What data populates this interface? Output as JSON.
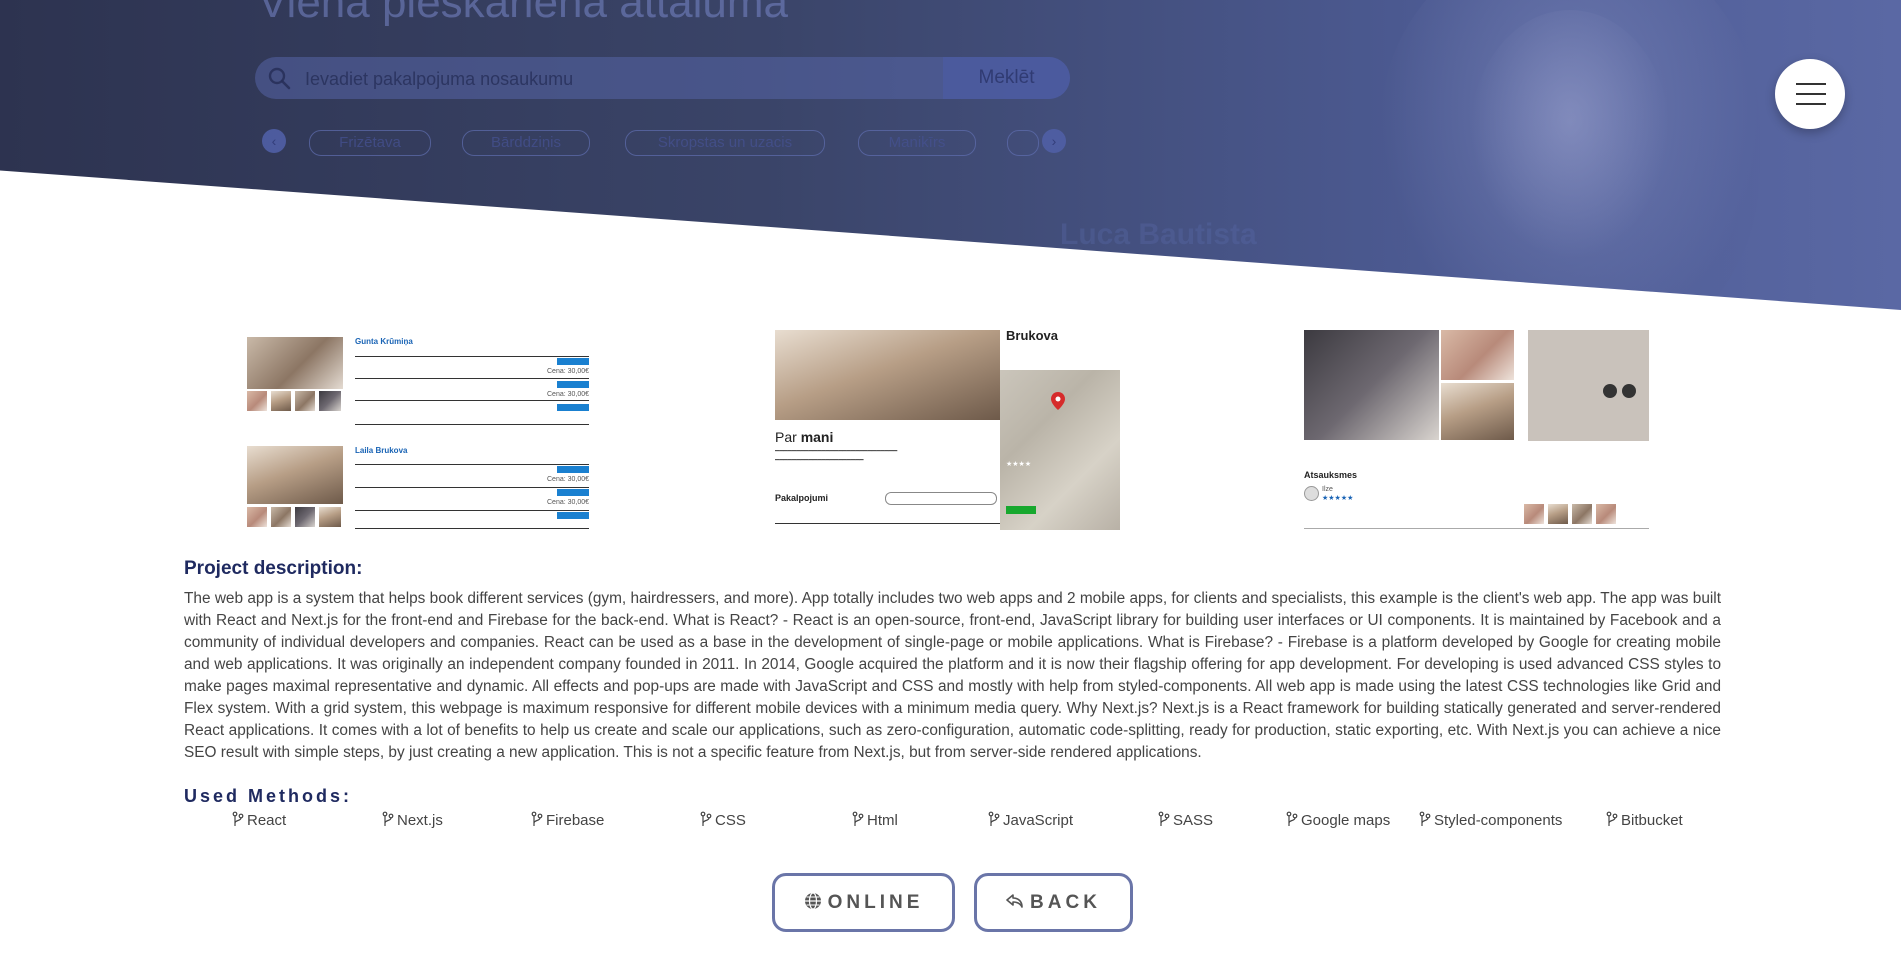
{
  "hero": {
    "title": "Vienā pieskārienā attālumā",
    "search_placeholder": "Ievadiet pakalpojuma nosaukumu",
    "search_button": "Meklēt",
    "categories": [
      "Frizētava",
      "Bārddziņis",
      "Skropstas un uzacis",
      "Manikīrs"
    ],
    "specialist_name": "Luca Bautista"
  },
  "screens": {
    "list": {
      "name1": "Gunta Krūmiņa",
      "name2": "Laila Brukova",
      "book_label": "Rezervēt",
      "price_label": "Cena: 30,00€"
    },
    "profile": {
      "name": "Brukova",
      "about_prefix": "Par",
      "about_bold": "mani",
      "services_label": "Pakalpojumi",
      "search_placeholder": "Ievadiet pakalpojuma nosaukumu"
    },
    "reviews": {
      "title": "Atsauksmes",
      "reviewer": "Ilze"
    }
  },
  "description": {
    "title": "Project description:",
    "text": "The web app is a system that helps book different services (gym, hairdressers, and more). App totally includes two web apps and 2 mobile apps, for clients and specialists, this example is the client's web app. The app was built with React and Next.js for the front-end and Firebase for the back-end. What is React? - React is an open-source, front-end, JavaScript library for building user interfaces or UI components. It is maintained by Facebook and a community of individual developers and companies. React can be used as a base in the development of single-page or mobile applications. What is Firebase? - Firebase is a platform developed by Google for creating mobile and web applications. It was originally an independent company founded in 2011. In 2014, Google acquired the platform and it is now their flagship offering for app development. For developing is used advanced CSS styles to make pages maximal representative and dynamic. All effects and pop-ups are made with JavaScript and CSS and mostly with help from styled-components. All web app is made using the latest CSS technologies like Grid and Flex system. With a grid system, this webpage is maximum responsive for different mobile devices with a minimum media query. Why Next.js? Next.js is a React framework for building statically generated and server-rendered React applications. It comes with a lot of benefits to help us create and scale our applications, such as zero-configuration, automatic code-splitting, ready for production, static exporting, etc. With Next.js you can achieve a nice SEO result with simple steps, by just creating a new application. This is not a specific feature from Next.js, but from server-side rendered applications."
  },
  "methods": {
    "title": "Used Methods:",
    "items": [
      "React",
      "Next.js",
      "Firebase",
      "CSS",
      "Html",
      "JavaScript",
      "SASS",
      "Google maps",
      "Styled-components",
      "Bitbucket"
    ]
  },
  "buttons": {
    "online": "ONLINE",
    "back": "BACK"
  },
  "colors": {
    "hero_start": "#2d3350",
    "hero_end": "#5a68a4",
    "heading": "#1f2a60",
    "button_border": "#6a75a8"
  }
}
